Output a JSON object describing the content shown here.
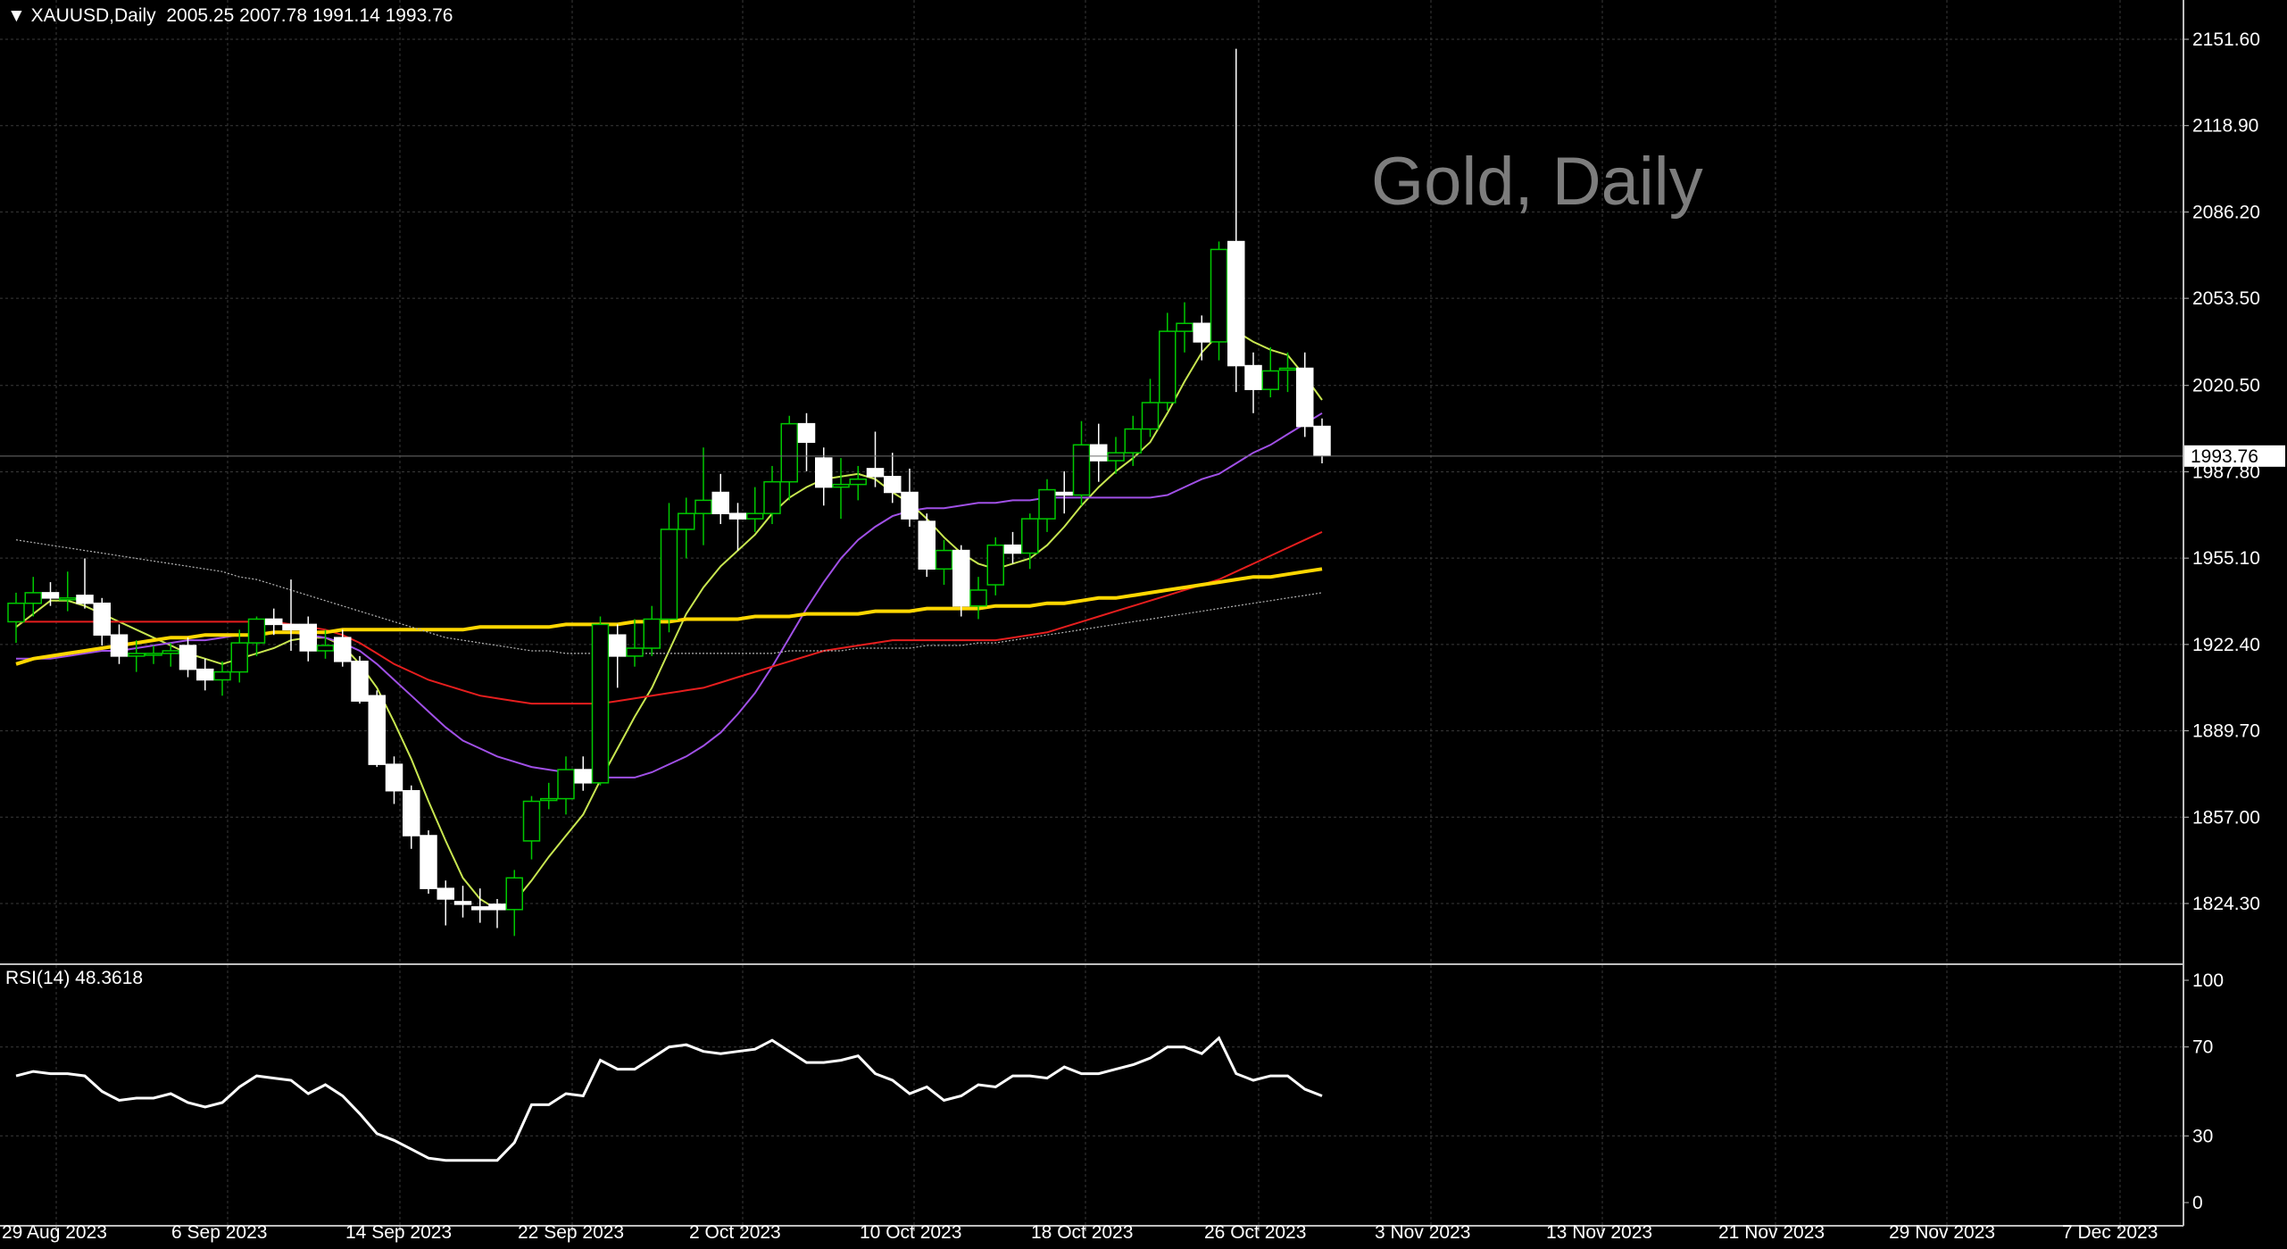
{
  "header": {
    "symbol": "XAUUSD,Daily",
    "ohlc": "2005.25 2007.78 1991.14 1993.76",
    "dropdown_icon": "triangle-down-icon",
    "watermark": "Gold, Daily",
    "rsi_label": "RSI(14) 48.3618"
  },
  "price_axis": {
    "ticks": [
      "2151.60",
      "2118.90",
      "2086.20",
      "2053.50",
      "2020.50",
      "1987.80",
      "1955.10",
      "1922.40",
      "1889.70",
      "1857.00",
      "1824.30"
    ],
    "current_price": "1993.76"
  },
  "rsi_axis": {
    "ticks": [
      "100",
      "70",
      "30",
      "0"
    ]
  },
  "time_axis": {
    "labels": [
      "29 Aug 2023",
      "6 Sep 2023",
      "14 Sep 2023",
      "22 Sep 2023",
      "2 Oct 2023",
      "10 Oct 2023",
      "18 Oct 2023",
      "26 Oct 2023",
      "3 Nov 2023",
      "13 Nov 2023",
      "21 Nov 2023",
      "29 Nov 2023",
      "7 Dec 2023"
    ]
  },
  "colors": {
    "background": "#000000",
    "bull_candle": "#00c800",
    "bear_candle": "#ffffff",
    "grid": "#3a3a3a",
    "ma_fast": "#c8e650",
    "ma_medium": "#a050e6",
    "ma_slow": "#e61e1e",
    "ma_long": "#ffd700",
    "ma_200": "#b4b4b4",
    "rsi_line": "#ffffff"
  },
  "chart_data": [
    {
      "type": "candlestick",
      "title": "XAUUSD,Daily",
      "ylim": [
        1800,
        2163
      ],
      "x_start": "2023-08-28",
      "candles": [
        {
          "o": 1931,
          "h": 1942,
          "l": 1923,
          "c": 1938
        },
        {
          "o": 1938,
          "h": 1948,
          "l": 1933,
          "c": 1942
        },
        {
          "o": 1942,
          "h": 1946,
          "l": 1937,
          "c": 1940
        },
        {
          "o": 1940,
          "h": 1950,
          "l": 1935,
          "c": 1940
        },
        {
          "o": 1941,
          "h": 1955,
          "l": 1936,
          "c": 1938
        },
        {
          "o": 1938,
          "h": 1940,
          "l": 1922,
          "c": 1926
        },
        {
          "o": 1926,
          "h": 1930,
          "l": 1915,
          "c": 1918
        },
        {
          "o": 1918,
          "h": 1924,
          "l": 1912,
          "c": 1919
        },
        {
          "o": 1919,
          "h": 1922,
          "l": 1915,
          "c": 1919
        },
        {
          "o": 1919,
          "h": 1923,
          "l": 1914,
          "c": 1920
        },
        {
          "o": 1922,
          "h": 1925,
          "l": 1910,
          "c": 1913
        },
        {
          "o": 1913,
          "h": 1917,
          "l": 1905,
          "c": 1909
        },
        {
          "o": 1909,
          "h": 1916,
          "l": 1903,
          "c": 1912
        },
        {
          "o": 1912,
          "h": 1928,
          "l": 1908,
          "c": 1923
        },
        {
          "o": 1923,
          "h": 1933,
          "l": 1918,
          "c": 1932
        },
        {
          "o": 1932,
          "h": 1936,
          "l": 1926,
          "c": 1930
        },
        {
          "o": 1930,
          "h": 1947,
          "l": 1920,
          "c": 1928
        },
        {
          "o": 1930,
          "h": 1933,
          "l": 1916,
          "c": 1920
        },
        {
          "o": 1920,
          "h": 1928,
          "l": 1917,
          "c": 1922
        },
        {
          "o": 1925,
          "h": 1928,
          "l": 1914,
          "c": 1916
        },
        {
          "o": 1916,
          "h": 1918,
          "l": 1900,
          "c": 1901
        },
        {
          "o": 1903,
          "h": 1905,
          "l": 1876,
          "c": 1877
        },
        {
          "o": 1877,
          "h": 1880,
          "l": 1862,
          "c": 1867
        },
        {
          "o": 1867,
          "h": 1869,
          "l": 1845,
          "c": 1850
        },
        {
          "o": 1850,
          "h": 1852,
          "l": 1828,
          "c": 1830
        },
        {
          "o": 1830,
          "h": 1833,
          "l": 1816,
          "c": 1826
        },
        {
          "o": 1825,
          "h": 1831,
          "l": 1819,
          "c": 1824
        },
        {
          "o": 1823,
          "h": 1830,
          "l": 1817,
          "c": 1822
        },
        {
          "o": 1824,
          "h": 1826,
          "l": 1815,
          "c": 1822
        },
        {
          "o": 1822,
          "h": 1837,
          "l": 1812,
          "c": 1834
        },
        {
          "o": 1848,
          "h": 1865,
          "l": 1841,
          "c": 1863
        },
        {
          "o": 1864,
          "h": 1870,
          "l": 1860,
          "c": 1864
        },
        {
          "o": 1864,
          "h": 1880,
          "l": 1858,
          "c": 1875
        },
        {
          "o": 1875,
          "h": 1880,
          "l": 1867,
          "c": 1870
        },
        {
          "o": 1870,
          "h": 1933,
          "l": 1869,
          "c": 1930
        },
        {
          "o": 1926,
          "h": 1930,
          "l": 1906,
          "c": 1918
        },
        {
          "o": 1918,
          "h": 1932,
          "l": 1914,
          "c": 1921
        },
        {
          "o": 1921,
          "h": 1937,
          "l": 1918,
          "c": 1932
        },
        {
          "o": 1932,
          "h": 1976,
          "l": 1927,
          "c": 1966
        },
        {
          "o": 1966,
          "h": 1978,
          "l": 1955,
          "c": 1972
        },
        {
          "o": 1972,
          "h": 1997,
          "l": 1960,
          "c": 1977
        },
        {
          "o": 1980,
          "h": 1987,
          "l": 1968,
          "c": 1972
        },
        {
          "o": 1972,
          "h": 1976,
          "l": 1958,
          "c": 1970
        },
        {
          "o": 1970,
          "h": 1982,
          "l": 1965,
          "c": 1972
        },
        {
          "o": 1972,
          "h": 1990,
          "l": 1968,
          "c": 1984
        },
        {
          "o": 1984,
          "h": 2009,
          "l": 1977,
          "c": 2006
        },
        {
          "o": 2006,
          "h": 2010,
          "l": 1988,
          "c": 1999
        },
        {
          "o": 1993,
          "h": 1997,
          "l": 1975,
          "c": 1982
        },
        {
          "o": 1982,
          "h": 1993,
          "l": 1970,
          "c": 1983
        },
        {
          "o": 1983,
          "h": 1990,
          "l": 1977,
          "c": 1985
        },
        {
          "o": 1989,
          "h": 2003,
          "l": 1982,
          "c": 1986
        },
        {
          "o": 1986,
          "h": 1995,
          "l": 1976,
          "c": 1980
        },
        {
          "o": 1980,
          "h": 1989,
          "l": 1967,
          "c": 1970
        },
        {
          "o": 1969,
          "h": 1972,
          "l": 1948,
          "c": 1951
        },
        {
          "o": 1951,
          "h": 1962,
          "l": 1945,
          "c": 1958
        },
        {
          "o": 1958,
          "h": 1960,
          "l": 1933,
          "c": 1937
        },
        {
          "o": 1937,
          "h": 1948,
          "l": 1932,
          "c": 1943
        },
        {
          "o": 1945,
          "h": 1963,
          "l": 1941,
          "c": 1960
        },
        {
          "o": 1960,
          "h": 1965,
          "l": 1953,
          "c": 1957
        },
        {
          "o": 1957,
          "h": 1972,
          "l": 1951,
          "c": 1970
        },
        {
          "o": 1970,
          "h": 1985,
          "l": 1965,
          "c": 1981
        },
        {
          "o": 1980,
          "h": 1988,
          "l": 1972,
          "c": 1979
        },
        {
          "o": 1979,
          "h": 2007,
          "l": 1975,
          "c": 1998
        },
        {
          "o": 1998,
          "h": 2006,
          "l": 1984,
          "c": 1992
        },
        {
          "o": 1992,
          "h": 2001,
          "l": 1987,
          "c": 1995
        },
        {
          "o": 1995,
          "h": 2009,
          "l": 1990,
          "c": 2004
        },
        {
          "o": 2004,
          "h": 2023,
          "l": 2001,
          "c": 2014
        },
        {
          "o": 2014,
          "h": 2048,
          "l": 2011,
          "c": 2041
        },
        {
          "o": 2041,
          "h": 2052,
          "l": 2033,
          "c": 2044
        },
        {
          "o": 2044,
          "h": 2047,
          "l": 2030,
          "c": 2037
        },
        {
          "o": 2037,
          "h": 2075,
          "l": 2030,
          "c": 2072
        },
        {
          "o": 2075,
          "h": 2148,
          "l": 2018,
          "c": 2028
        },
        {
          "o": 2028,
          "h": 2033,
          "l": 2010,
          "c": 2019
        },
        {
          "o": 2019,
          "h": 2035,
          "l": 2016,
          "c": 2026
        },
        {
          "o": 2027,
          "h": 2033,
          "l": 2018,
          "c": 2027
        },
        {
          "o": 2027,
          "h": 2033,
          "l": 2001,
          "c": 2005
        },
        {
          "o": 2005,
          "h": 2008,
          "l": 1991,
          "c": 1994
        }
      ],
      "series": [
        {
          "name": "",
          "color_key": "ma_fast",
          "values": [
            1929,
            1934,
            1939,
            1939,
            1937,
            1934,
            1931,
            1928,
            1925,
            1922,
            1919,
            1917,
            1915,
            1917,
            1919,
            1921,
            1924,
            1925,
            1925,
            1922,
            1915,
            1906,
            1893,
            1879,
            1863,
            1848,
            1834,
            1826,
            1822,
            1825,
            1833,
            1842,
            1850,
            1858,
            1871,
            1883,
            1895,
            1906,
            1920,
            1934,
            1944,
            1952,
            1958,
            1964,
            1972,
            1978,
            1982,
            1985,
            1986,
            1987,
            1985,
            1980,
            1976,
            1970,
            1963,
            1957,
            1953,
            1951,
            1953,
            1955,
            1960,
            1967,
            1975,
            1982,
            1988,
            1993,
            1999,
            2010,
            2022,
            2033,
            2040,
            2041,
            2037,
            2034,
            2032,
            2024,
            2015
          ]
        },
        {
          "name": "",
          "color_key": "ma_medium",
          "values": [
            1917,
            1917,
            1917,
            1918,
            1919,
            1920,
            1920,
            1921,
            1922,
            1923,
            1924,
            1924,
            1925,
            1926,
            1926,
            1927,
            1927,
            1926,
            1925,
            1923,
            1920,
            1915,
            1909,
            1903,
            1897,
            1891,
            1886,
            1883,
            1880,
            1878,
            1876,
            1875,
            1874,
            1873,
            1872,
            1872,
            1872,
            1874,
            1877,
            1880,
            1884,
            1889,
            1896,
            1904,
            1914,
            1925,
            1936,
            1946,
            1955,
            1962,
            1967,
            1971,
            1973,
            1974,
            1974,
            1975,
            1976,
            1976,
            1977,
            1977,
            1978,
            1978,
            1978,
            1978,
            1978,
            1978,
            1978,
            1979,
            1982,
            1985,
            1987,
            1991,
            1995,
            1998,
            2002,
            2006,
            2010
          ]
        },
        {
          "name": "",
          "color_key": "ma_slow",
          "values": [
            1931,
            1931,
            1931,
            1931,
            1931,
            1931,
            1931,
            1931,
            1931,
            1931,
            1931,
            1931,
            1931,
            1931,
            1931,
            1931,
            1930,
            1929,
            1928,
            1926,
            1923,
            1919,
            1915,
            1912,
            1909,
            1907,
            1905,
            1903,
            1902,
            1901,
            1900,
            1900,
            1900,
            1900,
            1900,
            1901,
            1902,
            1903,
            1904,
            1905,
            1906,
            1908,
            1910,
            1912,
            1914,
            1916,
            1918,
            1920,
            1921,
            1922,
            1923,
            1924,
            1924,
            1924,
            1924,
            1924,
            1924,
            1924,
            1925,
            1926,
            1927,
            1929,
            1931,
            1933,
            1935,
            1937,
            1939,
            1941,
            1943,
            1945,
            1947,
            1950,
            1953,
            1956,
            1959,
            1962,
            1965
          ]
        },
        {
          "name": "",
          "color_key": "ma_long",
          "values": [
            1915,
            1917,
            1918,
            1919,
            1920,
            1921,
            1922,
            1923,
            1924,
            1925,
            1925,
            1926,
            1926,
            1926,
            1926,
            1927,
            1927,
            1927,
            1927,
            1928,
            1928,
            1928,
            1928,
            1928,
            1928,
            1928,
            1928,
            1929,
            1929,
            1929,
            1929,
            1929,
            1930,
            1930,
            1930,
            1930,
            1931,
            1931,
            1931,
            1932,
            1932,
            1932,
            1932,
            1933,
            1933,
            1933,
            1934,
            1934,
            1934,
            1934,
            1935,
            1935,
            1935,
            1936,
            1936,
            1936,
            1936,
            1937,
            1937,
            1937,
            1938,
            1938,
            1939,
            1940,
            1940,
            1941,
            1942,
            1943,
            1944,
            1945,
            1946,
            1947,
            1948,
            1948,
            1949,
            1950,
            1951
          ]
        },
        {
          "name": "",
          "color_key": "ma_200",
          "values": [
            1962,
            1961,
            1960,
            1959,
            1958,
            1957,
            1956,
            1955,
            1954,
            1953,
            1952,
            1951,
            1950,
            1948,
            1947,
            1945,
            1943,
            1941,
            1939,
            1937,
            1935,
            1933,
            1931,
            1929,
            1927,
            1925,
            1924,
            1923,
            1922,
            1921,
            1920,
            1920,
            1919,
            1919,
            1919,
            1919,
            1919,
            1919,
            1919,
            1919,
            1919,
            1919,
            1919,
            1919,
            1919,
            1920,
            1920,
            1920,
            1920,
            1921,
            1921,
            1921,
            1921,
            1922,
            1922,
            1922,
            1923,
            1923,
            1924,
            1925,
            1926,
            1927,
            1928,
            1929,
            1930,
            1931,
            1932,
            1933,
            1934,
            1935,
            1936,
            1937,
            1938,
            1939,
            1940,
            1941,
            1942
          ]
        }
      ]
    },
    {
      "type": "line",
      "title": "RSI(14) 48.3618",
      "ylim": [
        0,
        100
      ],
      "levels": [
        70,
        30
      ],
      "series": [
        {
          "name": "RSI(14)",
          "color_key": "rsi_line",
          "values": [
            57,
            59,
            58,
            58,
            57,
            50,
            46,
            47,
            47,
            49,
            45,
            43,
            45,
            52,
            57,
            56,
            55,
            49,
            53,
            48,
            40,
            31,
            28,
            24,
            20,
            19,
            19,
            19,
            19,
            27,
            44,
            44,
            49,
            48,
            64,
            60,
            60,
            65,
            70,
            71,
            68,
            67,
            68,
            69,
            73,
            68,
            63,
            63,
            64,
            66,
            58,
            55,
            49,
            52,
            46,
            48,
            53,
            52,
            57,
            57,
            56,
            61,
            58,
            58,
            60,
            62,
            65,
            70,
            70,
            67,
            74,
            58,
            55,
            57,
            57,
            51,
            48
          ]
        }
      ]
    }
  ]
}
